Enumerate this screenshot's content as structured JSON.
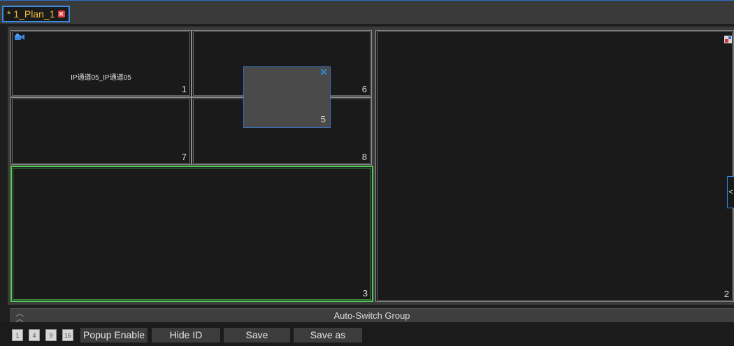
{
  "tab": {
    "title": "* 1_Plan_1",
    "close_icon": "close-icon"
  },
  "cells": {
    "c1": {
      "number": "1",
      "label": "IP通道05_IP通道05"
    },
    "c6": {
      "number": "6"
    },
    "c7": {
      "number": "7"
    },
    "c8": {
      "number": "8"
    },
    "c3": {
      "number": "3"
    },
    "c2": {
      "number": "2"
    }
  },
  "popup": {
    "number": "5",
    "close_icon": "close-icon"
  },
  "side_handle": {
    "glyph": "<"
  },
  "auto_switch": {
    "label": "Auto-Switch Group",
    "toggle_icon": "chevron-double-up-icon"
  },
  "toolbar": {
    "layouts": [
      "1",
      "4",
      "9",
      "16"
    ],
    "popup_enable": "Popup Enable",
    "hide_id": "Hide ID",
    "save": "Save",
    "save_as": "Save as"
  },
  "colors": {
    "tab_text": "#f0c030",
    "accent_blue": "#2b87e0",
    "selected_green": "#56c656"
  }
}
